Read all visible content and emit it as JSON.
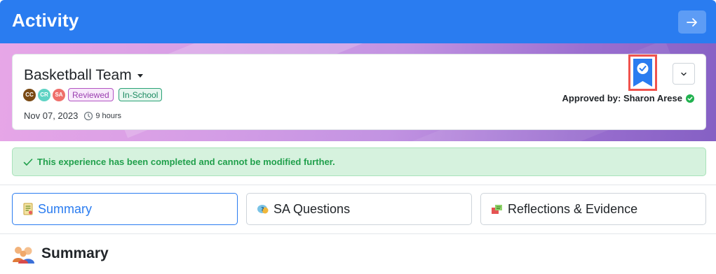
{
  "header": {
    "title": "Activity",
    "nav_icon": "arrow-right-icon"
  },
  "activity": {
    "title": "Basketball Team",
    "participants": [
      {
        "initials": "CC",
        "color": "#7a4a14"
      },
      {
        "initials": "CR",
        "color": "#5fd3c4"
      },
      {
        "initials": "SA",
        "color": "#ef6f6b"
      }
    ],
    "status_badge": "Reviewed",
    "location_badge": "In-School",
    "date": "Nov 07, 2023",
    "duration": "9 hours",
    "approved_by": "Approved by: Sharon Arese"
  },
  "alert": {
    "message": "This experience has been completed and cannot be modified further."
  },
  "tabs": [
    {
      "label": "Summary",
      "icon": "summary-icon",
      "active": true
    },
    {
      "label": "SA Questions",
      "icon": "sa-questions-icon",
      "active": false
    },
    {
      "label": "Reflections & Evidence",
      "icon": "reflections-icon",
      "active": false
    }
  ],
  "section": {
    "title": "Summary",
    "icon": "people-icon"
  },
  "colors": {
    "primary": "#2a7cf0",
    "success": "#21a04c",
    "reviewed": "#9b3fb0",
    "in_school": "#1b8a60"
  }
}
